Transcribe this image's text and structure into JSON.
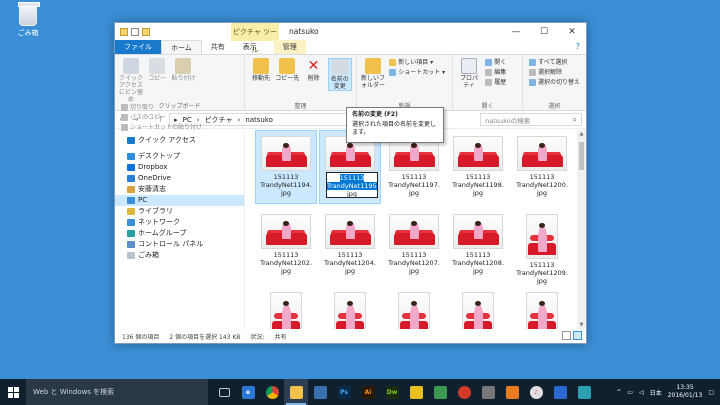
{
  "desktop": {
    "recycle_label": "ごみ箱"
  },
  "window": {
    "title": "natsuko",
    "context_tab": "ピクチャ ツール",
    "tabs": {
      "file": "ファイル",
      "home": "ホーム",
      "share": "共有",
      "view": "表示",
      "manage": "管理"
    }
  },
  "ribbon": {
    "clipboard": {
      "pin": "クイック アクセスにピン留め",
      "copy": "コピー",
      "paste": "貼り付け",
      "cut": "切り取り",
      "copy_path": "パスのコピー",
      "paste_shortcut": "ショートカットの貼り付け",
      "label": "クリップボード"
    },
    "organize": {
      "move": "移動先",
      "copy_to": "コピー先",
      "delete": "削除",
      "rename": "名前の変更",
      "label": "整理"
    },
    "new": {
      "new_folder": "新しいフォルダー",
      "new_item": "新しい項目",
      "shortcut": "ショートカット",
      "label": "新規"
    },
    "open": {
      "properties": "プロパティ",
      "open": "開く",
      "edit": "編集",
      "history": "履歴",
      "label": "開く"
    },
    "select": {
      "select_all": "すべて選択",
      "select_none": "選択解除",
      "invert": "選択の切り替え",
      "label": "選択"
    }
  },
  "tooltip": {
    "title": "名前の変更 (F2)",
    "desc": "選択された項目の名前を変更します。"
  },
  "address": {
    "path": [
      "PC",
      "ピクチャ",
      "natsuko"
    ],
    "search_placeholder": "natsukoの検索"
  },
  "nav": [
    {
      "label": "クイック アクセス",
      "icon": "star-icon",
      "color": "#1979ca"
    },
    {
      "label": "デスクトップ",
      "icon": "desktop-icon",
      "color": "#2f8fd8"
    },
    {
      "label": "Dropbox",
      "icon": "dropbox-icon",
      "color": "#0d6fd9"
    },
    {
      "label": "OneDrive",
      "icon": "onedrive-icon",
      "color": "#2a7fd4"
    },
    {
      "label": "安藤清志",
      "icon": "user-icon",
      "color": "#d9a441"
    },
    {
      "label": "PC",
      "icon": "pc-icon",
      "color": "#3b8fd6"
    },
    {
      "label": "ライブラリ",
      "icon": "library-icon",
      "color": "#e0b53a"
    },
    {
      "label": "ネットワーク",
      "icon": "network-icon",
      "color": "#3b8fd6"
    },
    {
      "label": "ホームグループ",
      "icon": "homegroup-icon",
      "color": "#2aa0a0"
    },
    {
      "label": "コントロール パネル",
      "icon": "control-panel-icon",
      "color": "#5a8fc8"
    },
    {
      "label": "ごみ箱",
      "icon": "recycle-bin-icon",
      "color": "#b8c2cc"
    }
  ],
  "files": [
    {
      "l1": "151113",
      "l2": "TrandyNet1194.",
      "l3": "jpg"
    },
    {
      "l1": "151113",
      "l2": "TrandyNet1195",
      "l3": "jpg"
    },
    {
      "l1": "151113",
      "l2": "TrandyNet1197.",
      "l3": "jpg"
    },
    {
      "l1": "151113",
      "l2": "TrandyNet1198.",
      "l3": "jpg"
    },
    {
      "l1": "151113",
      "l2": "TrandyNet1200.",
      "l3": "jpg"
    },
    {
      "l1": "151113",
      "l2": "TrandyNet1202.",
      "l3": "jpg"
    },
    {
      "l1": "151113",
      "l2": "TrandyNet1204.",
      "l3": "jpg"
    },
    {
      "l1": "151113",
      "l2": "TrandyNet1207.",
      "l3": "jpg"
    },
    {
      "l1": "151113",
      "l2": "TrandyNet1208.",
      "l3": "jpg"
    },
    {
      "l1": "151113",
      "l2": "TrandyNet1209.",
      "l3": "jpg"
    },
    {
      "l1": "",
      "l2": "",
      "l3": ""
    },
    {
      "l1": "",
      "l2": "",
      "l3": ""
    },
    {
      "l1": "",
      "l2": "",
      "l3": ""
    },
    {
      "l1": "",
      "l2": "",
      "l3": ""
    },
    {
      "l1": "",
      "l2": "",
      "l3": ""
    }
  ],
  "rename_box": {
    "pre": "151113",
    "highlight_line2": "TrandyNet1195",
    "rest_line2": ".",
    "line3": "jpg"
  },
  "status": {
    "count": "136 個の項目",
    "selected": "2 個の項目を選択 143 KB",
    "state": "状況:",
    "shared": "共有"
  },
  "taskbar": {
    "search": "Web と Windows を検索",
    "lang": "日本",
    "time": "13:35",
    "date": "2016/01/13"
  }
}
